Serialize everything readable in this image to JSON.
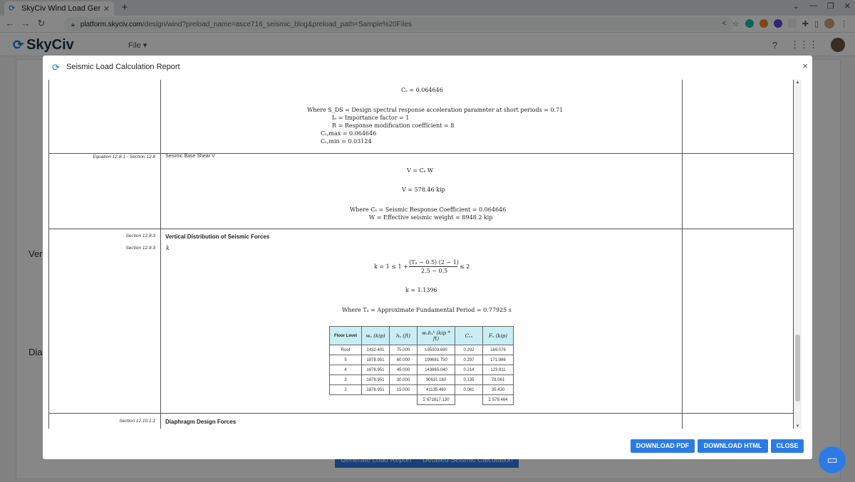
{
  "browser": {
    "tab_title": "SkyCiv Wind Load Genera",
    "url_host": "platform.skyciv.com",
    "url_path": "/design/wind?preload_name=asce716_seismic_blog&preload_path=Sample%20Files"
  },
  "app": {
    "logo_text": "SkyCiv",
    "file_menu": "File ▾",
    "bg_labels": [
      "Ver",
      "Dia"
    ],
    "bg_buttons": [
      "Generate Load Report",
      "Detailed Seismic Calculation"
    ]
  },
  "modal": {
    "title": "Seismic Load Calculation Report",
    "close_glyph": "×",
    "buttons": {
      "download_pdf": "DOWNLOAD PDF",
      "download_html": "DOWNLOAD HTML",
      "close": "CLOSE"
    }
  },
  "report": {
    "cs_value": "Cₛ = 0.064646",
    "where_lines": [
      "Where S_DS = Design spectral response acceleration parameter at short periods = 0.71",
      "Iₑ = Importance factor = 1",
      "R = Response modification coefficient = 8",
      "Cₛ,max = 0.064646",
      "Cₛ,min = 0.03124"
    ],
    "shear": {
      "ref": "Equation 12.8-1 - Section 12.8",
      "label": "Seismic Base Shear V",
      "eq": "V = Cₛ W",
      "result": "V = 578.46 kip",
      "where1": "Where Cₛ = Seismic Response Coefficient = 0.064646",
      "where2": "W = Effective seismic weight = 8948.2 kip"
    },
    "vert": {
      "ref1": "Section 12.8.3",
      "title": "Vertical Distribution of Seismic Forces",
      "ref2": "Section 12.8.3",
      "k_label": "k",
      "k_eq_left": "k = 1 ≤ 1 +",
      "k_eq_num": "(Tₐ − 0.5) (2 − 1)",
      "k_eq_den": "2.5 − 0.5",
      "k_eq_right": "≤ 2",
      "k_result": "k = 1.1396",
      "ta_where": "Where Tₐ = Approximate Fundamental Period = 0.77925 s"
    },
    "floor_table": {
      "headers": [
        "Floor Level",
        "wₓ (kip)",
        "hₓ (ft)",
        "wₓhₓᵏ (kip * ft)",
        "Cᵥₓ",
        "Fₓ (kip)"
      ],
      "rows": [
        [
          "Roof",
          "1432.401",
          "75.000",
          "195303.690",
          "0.292",
          "169.076"
        ],
        [
          "5",
          "1878.951",
          "60.000",
          "199681.750",
          "0.297",
          "171.986"
        ],
        [
          "4",
          "1878.951",
          "45.000",
          "143865.040",
          "0.214",
          "123.911"
        ],
        [
          "3",
          "1878.951",
          "30.000",
          "90631.160",
          "0.135",
          "78.061"
        ],
        [
          "2",
          "1878.951",
          "15.000",
          "41135.490",
          "0.061",
          "35.430"
        ]
      ],
      "sum_wh": "Σ 671617.130",
      "sum_f": "Σ 578.464"
    },
    "diaphragm": {
      "ref": "Section 12.10.1.1",
      "title": "Diaphragm Design Forces"
    }
  }
}
